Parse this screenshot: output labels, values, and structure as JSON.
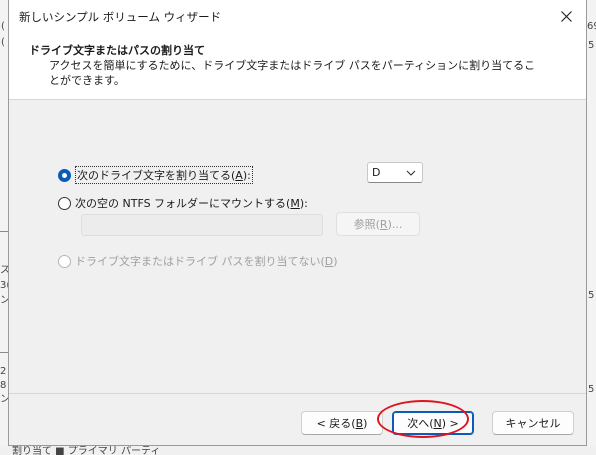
{
  "window": {
    "title": "新しいシンプル ボリューム ウィザード"
  },
  "header": {
    "title": "ドライブ文字またはパスの割り当て",
    "description": "アクセスを簡単にするために、ドライブ文字またはドライブ パスをパーティションに割り当てることができます。"
  },
  "options": {
    "assign_letter": {
      "label": "次のドライブ文字を割り当てる(",
      "mnemonic": "A",
      "suffix": "):",
      "checked": true
    },
    "mount_folder": {
      "label": "次の空の NTFS フォルダーにマウントする(",
      "mnemonic": "M",
      "suffix": "):",
      "checked": false
    },
    "no_assign": {
      "label": "ドライブ文字またはドライブ パスを割り当てない(",
      "mnemonic": "D",
      "suffix": ")",
      "checked": false,
      "disabled": true
    }
  },
  "drive_letter": {
    "selected": "D"
  },
  "folder_path": {
    "value": ""
  },
  "browse": {
    "label": "参照(",
    "mnemonic": "R",
    "suffix": ")..."
  },
  "footer": {
    "back": {
      "label": "< 戻る(",
      "mnemonic": "B",
      "suffix": ")"
    },
    "next": {
      "label": "次へ(",
      "mnemonic": "N",
      "suffix": ") >"
    },
    "cancel": {
      "label": "キャンセル"
    }
  },
  "background": {
    "frag_1": "(",
    "frag_2": "(",
    "frag_3": "ス",
    "frag_4": "3(",
    "frag_5": "ン",
    "frag_6": "2",
    "frag_7": "8",
    "frag_8": "ン",
    "frag_r1": "69",
    "frag_r2": "5",
    "frag_r3": "5",
    "frag_r4": "5",
    "frag_bottom": "割り当て ■ プライマリ パーティ"
  },
  "colors": {
    "accent": "#0a5cb8",
    "annotation": "#e0141e",
    "dialog_bg": "#f0f0f0"
  }
}
